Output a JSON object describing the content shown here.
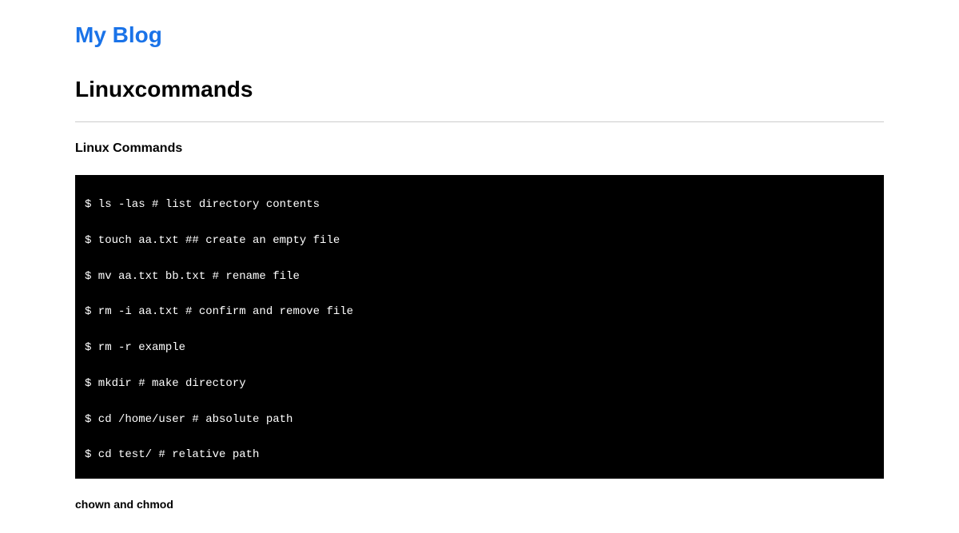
{
  "site_title": "My Blog",
  "page_title": "Linuxcommands",
  "section_heading": "Linux Commands",
  "code_block": "$ ls -las # list directory contents\n\n$ touch aa.txt ## create an empty file\n\n$ mv aa.txt bb.txt # rename file\n\n$ rm -i aa.txt # confirm and remove file\n\n$ rm -r example\n\n$ mkdir # make directory\n\n$ cd /home/user # absolute path\n\n$ cd test/ # relative path",
  "sub_heading": "chown and chmod"
}
